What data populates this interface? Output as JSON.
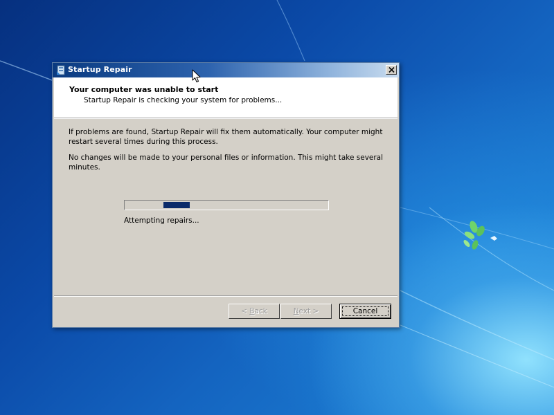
{
  "window": {
    "title": "Startup Repair",
    "close_label": "✕"
  },
  "header": {
    "title": "Your computer was unable to start",
    "subtitle": "Startup Repair is checking your system for problems..."
  },
  "body": {
    "paragraph1": "If problems are found, Startup Repair will fix them automatically. Your computer might restart several times during this process.",
    "paragraph2": "No changes will be made to your personal files or information. This might take several minutes."
  },
  "progress": {
    "style": "marquee",
    "chunk_start_fraction": 0.19,
    "chunk_end_fraction": 0.32,
    "status": "Attempting repairs..."
  },
  "buttons": {
    "back": {
      "label": "< Back",
      "mnemonic": "B",
      "enabled": false
    },
    "next": {
      "label": "Next >",
      "mnemonic": "N",
      "enabled": false
    },
    "cancel": {
      "label": "Cancel",
      "enabled": true,
      "default": true
    }
  },
  "colors": {
    "titlebar_start": "#0a3a80",
    "progress_fill": "#0a2a6a",
    "dialog_face": "#d4d0c8"
  },
  "icons": {
    "window": "startup-repair-icon",
    "close": "close-icon",
    "pointer": "mouse-cursor-icon"
  }
}
